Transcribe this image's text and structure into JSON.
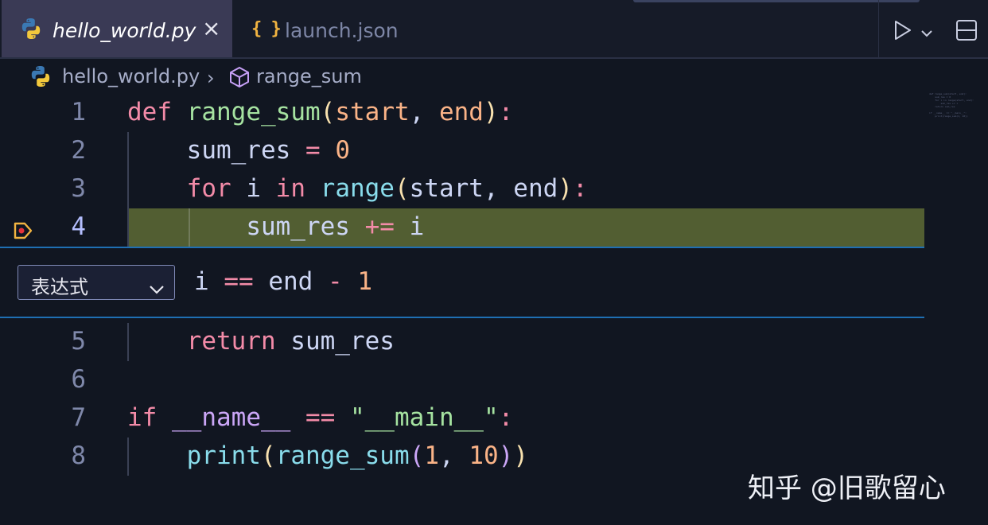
{
  "tabs": [
    {
      "label": "hello_world.py",
      "icon": "python-icon",
      "active": true
    },
    {
      "label": "launch.json",
      "icon": "json-braces-icon",
      "active": false
    }
  ],
  "tab_close_glyph": "×",
  "breadcrumb": {
    "file": "hello_world.py",
    "separator": "›",
    "symbol": "range_sum"
  },
  "code_lines": [
    {
      "num": "1",
      "tokens": [
        {
          "t": "def",
          "c": "kw"
        },
        {
          "t": " ",
          "c": "pl"
        },
        {
          "t": "range_sum",
          "c": "fn"
        },
        {
          "t": "(",
          "c": "br"
        },
        {
          "t": "start",
          "c": "pm"
        },
        {
          "t": ", ",
          "c": "pc"
        },
        {
          "t": "end",
          "c": "pm"
        },
        {
          "t": ")",
          "c": "br"
        },
        {
          "t": ":",
          "c": "op"
        }
      ]
    },
    {
      "num": "2",
      "tokens": [
        {
          "t": "    ",
          "c": "pl"
        },
        {
          "t": "sum_res",
          "c": "pl"
        },
        {
          "t": " ",
          "c": "pl"
        },
        {
          "t": "=",
          "c": "op"
        },
        {
          "t": " ",
          "c": "pl"
        },
        {
          "t": "0",
          "c": "nm"
        }
      ]
    },
    {
      "num": "3",
      "tokens": [
        {
          "t": "    ",
          "c": "pl"
        },
        {
          "t": "for",
          "c": "kw"
        },
        {
          "t": " i ",
          "c": "pl"
        },
        {
          "t": "in",
          "c": "kw"
        },
        {
          "t": " ",
          "c": "pl"
        },
        {
          "t": "range",
          "c": "bi"
        },
        {
          "t": "(",
          "c": "br"
        },
        {
          "t": "start, end",
          "c": "pl"
        },
        {
          "t": ")",
          "c": "br"
        },
        {
          "t": ":",
          "c": "op"
        }
      ]
    },
    {
      "num": "4",
      "current": true,
      "tokens": [
        {
          "t": "        ",
          "c": "pl"
        },
        {
          "t": "sum_res",
          "c": "pl"
        },
        {
          "t": " ",
          "c": "pl"
        },
        {
          "t": "+=",
          "c": "op"
        },
        {
          "t": " i",
          "c": "pl"
        }
      ]
    },
    {
      "num": "5",
      "tokens": [
        {
          "t": "    ",
          "c": "pl"
        },
        {
          "t": "return",
          "c": "kw"
        },
        {
          "t": " sum_res",
          "c": "pl"
        }
      ]
    },
    {
      "num": "6",
      "tokens": []
    },
    {
      "num": "7",
      "tokens": [
        {
          "t": "if",
          "c": "kw"
        },
        {
          "t": " ",
          "c": "pl"
        },
        {
          "t": "__name__",
          "c": "dn"
        },
        {
          "t": " ",
          "c": "pl"
        },
        {
          "t": "==",
          "c": "op"
        },
        {
          "t": " ",
          "c": "pl"
        },
        {
          "t": "\"__main__\"",
          "c": "st"
        },
        {
          "t": ":",
          "c": "op"
        }
      ]
    },
    {
      "num": "8",
      "tokens": [
        {
          "t": "    ",
          "c": "pl"
        },
        {
          "t": "print",
          "c": "bi"
        },
        {
          "t": "(",
          "c": "br"
        },
        {
          "t": "range_sum",
          "c": "bi"
        },
        {
          "t": "(",
          "c": "dn"
        },
        {
          "t": "1",
          "c": "nm"
        },
        {
          "t": ", ",
          "c": "pc"
        },
        {
          "t": "10",
          "c": "nm"
        },
        {
          "t": ")",
          "c": "dn"
        },
        {
          "t": ")",
          "c": "br"
        }
      ]
    }
  ],
  "breakpoint_widget": {
    "type_select": "表达式",
    "expression": [
      {
        "t": "i ",
        "c": "pl"
      },
      {
        "t": "==",
        "c": "op"
      },
      {
        "t": " end ",
        "c": "pl"
      },
      {
        "t": "-",
        "c": "op"
      },
      {
        "t": " ",
        "c": "pl"
      },
      {
        "t": "1",
        "c": "nm"
      }
    ]
  },
  "minimap_text": "def range_sum(start, end):\n    sum_res = 0\n    for i in range(start, end):\n        sum_res += i\n    return sum_res\n\nif __name__ == \"__main__\":\n    print(range_sum(1, 10))",
  "watermark": "知乎 @旧歌留心",
  "colors": {
    "background": "#111621",
    "current_line_highlight": "#525e32",
    "widget_border": "#1f6fb3",
    "keyword": "#f38ba8",
    "function": "#a6e3a1",
    "builtin": "#89dceb",
    "parameter": "#fab387",
    "breakpoint": "#f2b441"
  }
}
